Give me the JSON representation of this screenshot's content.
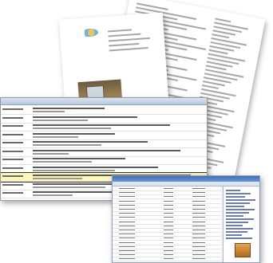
{
  "scene": "collage-of-document-screenshots",
  "colors": {
    "paper": "#ffffff",
    "highlight": "#fff7b8",
    "title_bar": "#3d6fb5",
    "header_band": "#c8d6e6"
  },
  "icons": {
    "logo": "circular-logo-icon",
    "photo": "kitchen-photo-image"
  },
  "list": {
    "highlighted_row": 8
  }
}
